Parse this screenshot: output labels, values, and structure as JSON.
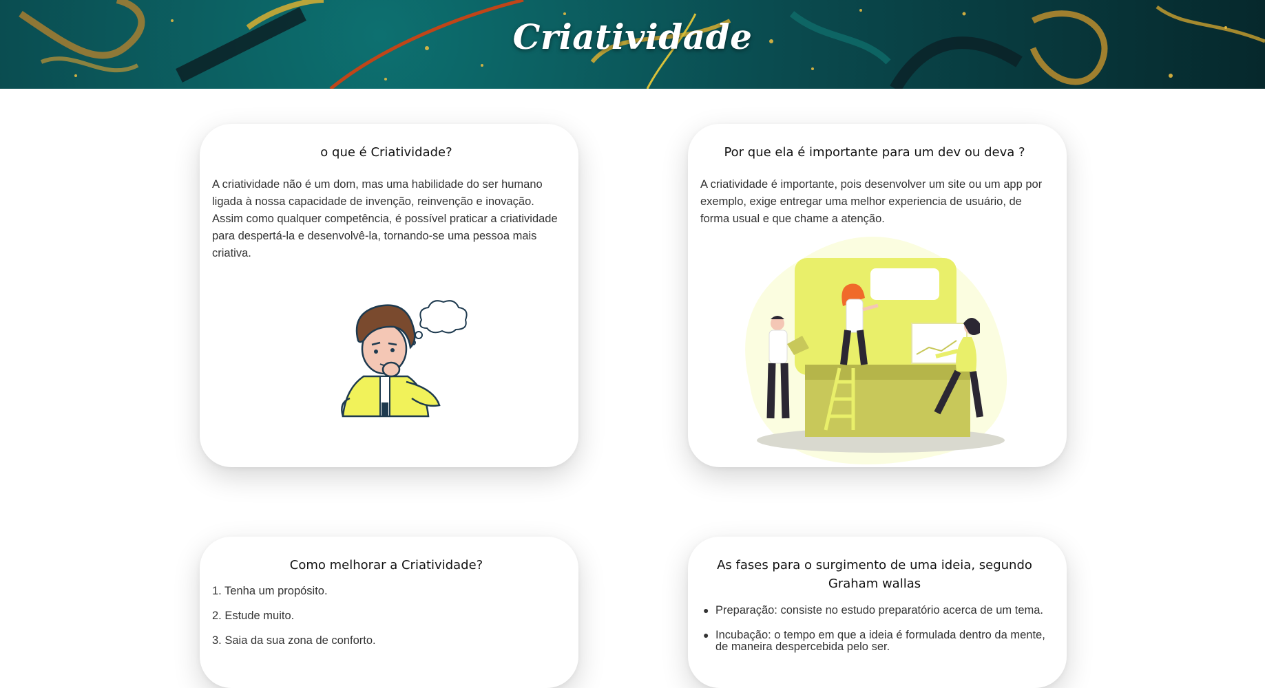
{
  "header": {
    "title": "Criatividade"
  },
  "cards": [
    {
      "title": "o que é Criatividade?",
      "text": "A criatividade não é um dom, mas uma habilidade do ser humano ligada à nossa capacidade de invenção, reinvenção e inovação. Assim como qualquer competência, é possível praticar a criatividade para despertá-la e desenvolvê-la, tornando-se uma pessoa mais criativa.",
      "illustration": "thinking-man-illustration"
    },
    {
      "title": "Por que ela é importante para um dev ou deva ?",
      "text": "A criatividade é importante, pois desenvolver um site ou um app por exemplo, exige entregar uma melhor experiencia de usuário, de forma usual e que chame a atenção.",
      "illustration": "team-collaboration-illustration"
    },
    {
      "title": "Como melhorar a Criatividade?",
      "items": [
        "1. Tenha um propósito.",
        "2. Estude muito.",
        "3. Saia da sua zona de conforto."
      ]
    },
    {
      "title": "As fases para o surgimento de uma ideia, segundo Graham wallas",
      "items": [
        "Preparação: consiste no estudo preparatório acerca de um tema.",
        "Incubação: o tempo em que a ideia é formulada dentro da mente, de maneira despercebida pelo ser."
      ]
    }
  ],
  "colors": {
    "accent_yellow": "#f1f25a",
    "banner_teal": "#0a4b4f",
    "text": "#333333"
  }
}
